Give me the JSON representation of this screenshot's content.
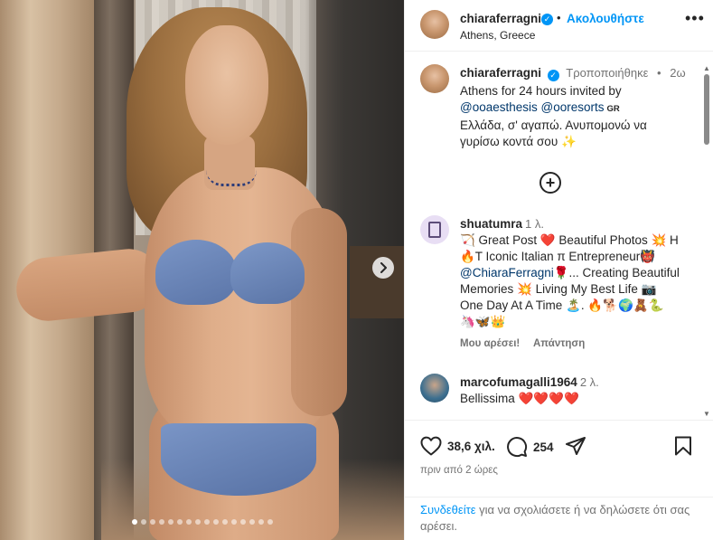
{
  "post": {
    "username": "chiaraferragni",
    "follow_label": "Ακολουθήστε",
    "separator": "•",
    "location": "Athens, Greece",
    "more_label": "•••"
  },
  "caption": {
    "username": "chiaraferragni",
    "edited_label": "Τροποποιήθηκε",
    "time_separator": "•",
    "time": "2ω",
    "line1": "Athens for 24 hours invited by",
    "mention1": "@ooaesthesis",
    "mention2": "@ooresorts",
    "tag_code": "GR",
    "line3": "Ελλάδα, σ' αγαπώ. Ανυπομονώ να γυρίσω κοντά σου ✨"
  },
  "comments": [
    {
      "username": "shuatumra",
      "time": "1 λ.",
      "text_before_mention": "🏹 Great Post ❤️ Beautiful Photos 💥 H🔥T Iconic Italian π Entrepreneur👹",
      "mention": "@ChiaraFerragni",
      "text_after_mention": "🌹... Creating Beautiful Memories 💥 Living My Best Life 📷 One Day At A Time 🏝️. 🔥🐕🌍🧸🐍 🦄🦋👑",
      "like_label": "Μου αρέσει!",
      "reply_label": "Απάντηση"
    },
    {
      "username": "marcofumagalli1964",
      "time": "2 λ.",
      "text": "Bellissima ❤️❤️❤️❤️"
    }
  ],
  "stats": {
    "likes": "38,6 χιλ.",
    "comments": "254",
    "posted_ago": "πριν από 2 ώρες"
  },
  "login_prompt": {
    "link": "Συνδεθείτε",
    "rest": " για να σχολιάσετε ή να δηλώσετε ότι σας αρέσει."
  },
  "carousel": {
    "slide_count": 16,
    "active_index": 0
  },
  "colors": {
    "accent": "#0095f6",
    "mention": "#00376b",
    "muted": "#737373",
    "heart": "#ed4956"
  }
}
